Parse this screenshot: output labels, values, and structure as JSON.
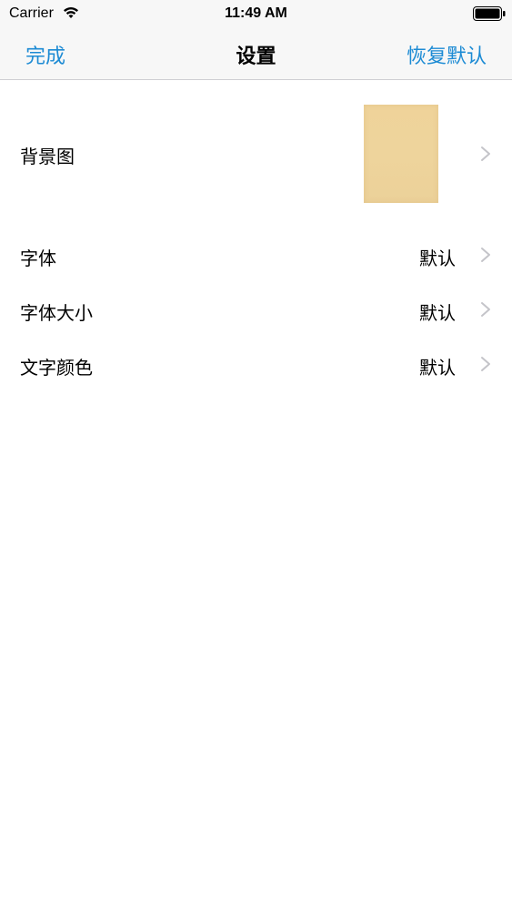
{
  "status_bar": {
    "carrier": "Carrier",
    "time": "11:49 AM",
    "icons": [
      "wifi-icon",
      "battery-icon"
    ]
  },
  "nav": {
    "left_label": "完成",
    "title": "设置",
    "right_label": "恢复默认",
    "accent_color": "#1d8bd4"
  },
  "settings": {
    "background": {
      "label": "背景图",
      "icon": "chevron-right-icon"
    },
    "font": {
      "label": "字体",
      "value": "默认"
    },
    "font_size": {
      "label": "字体大小",
      "value": "默认"
    },
    "text_color": {
      "label": "文字颜色",
      "value": "默认"
    }
  }
}
